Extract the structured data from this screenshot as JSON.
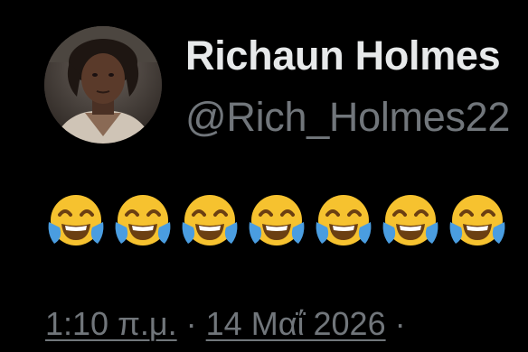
{
  "tweet": {
    "author": {
      "display_name": "Richaun Holmes",
      "handle": "@Rich_Holmes22",
      "avatar_icon": "profile-photo"
    },
    "text_emoji": [
      "😂",
      "😂",
      "😂",
      "😂",
      "😂",
      "😂",
      "😂"
    ],
    "emoji_icon": "face-with-tears-of-joy-icon",
    "timestamp": {
      "time": "1:10 π.μ.",
      "separator": "·",
      "date": "14 Μαΐ 2026",
      "trailing_separator": "·"
    }
  },
  "colors": {
    "background": "#000000",
    "primary_text": "#e7e9ea",
    "secondary_text": "#71767b",
    "emoji_face": "#f6c22f",
    "emoji_tears": "#4a9de0"
  }
}
